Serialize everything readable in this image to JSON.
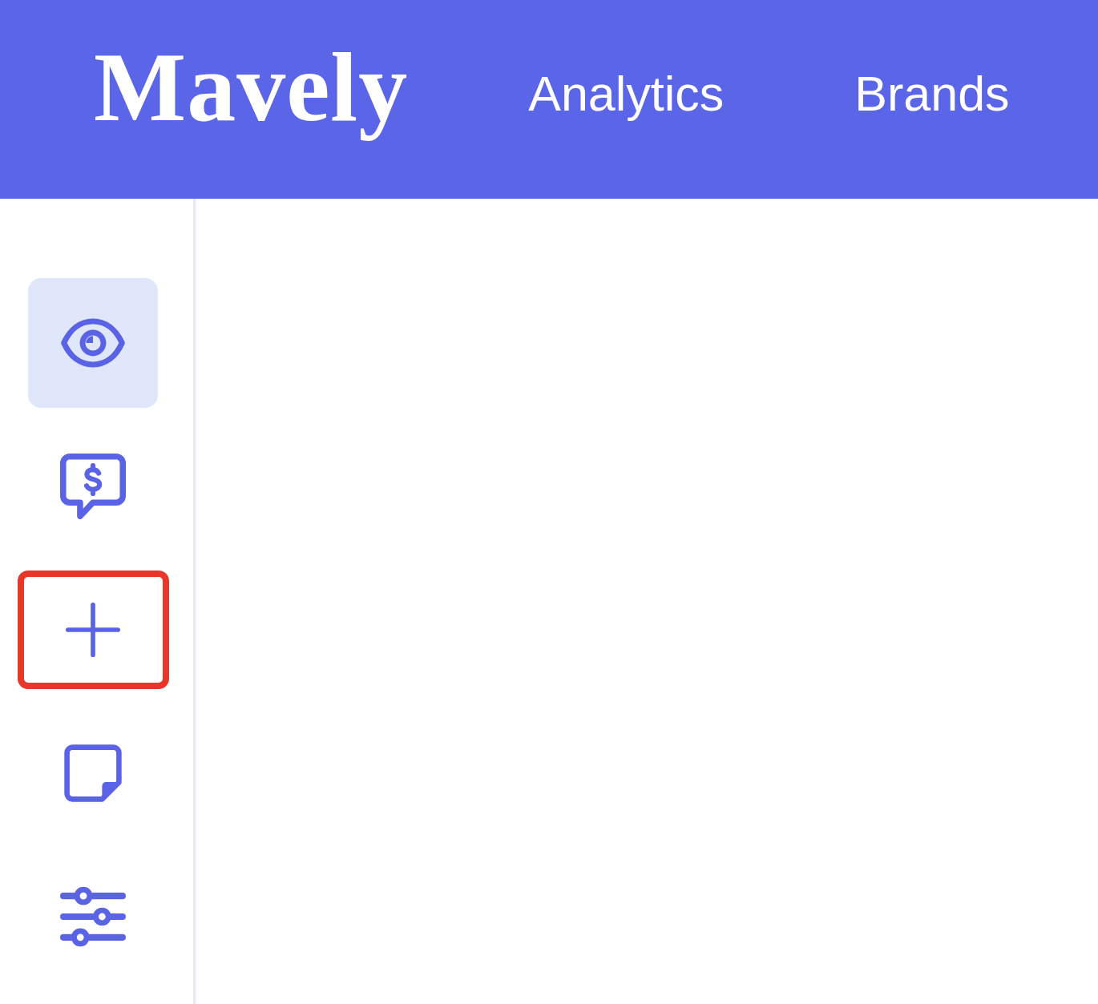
{
  "header": {
    "logo": "Mavely",
    "nav": [
      {
        "label": "Analytics"
      },
      {
        "label": "Brands"
      }
    ]
  },
  "sidebar": {
    "items": [
      {
        "selected": true,
        "highlighted": false
      },
      {
        "selected": false,
        "highlighted": false
      },
      {
        "selected": false,
        "highlighted": true
      },
      {
        "selected": false,
        "highlighted": false
      },
      {
        "selected": false,
        "highlighted": false
      }
    ]
  }
}
